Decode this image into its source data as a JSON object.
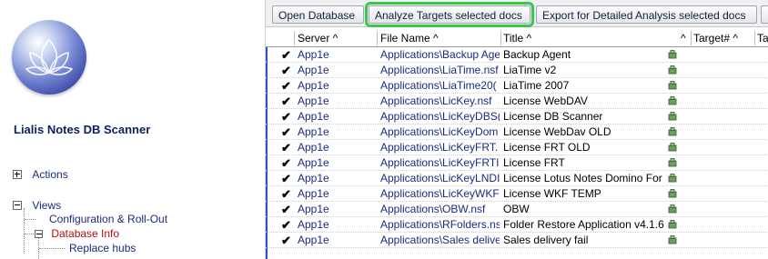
{
  "navigator": {
    "app_title": "Lialis Notes DB Scanner",
    "tree": [
      {
        "label": "Actions",
        "state": "collapsed"
      },
      {
        "label": "Views",
        "state": "expanded"
      }
    ],
    "views_children": [
      {
        "label": "Configuration & Roll-Out"
      },
      {
        "label": "Database Info",
        "state": "expanded",
        "active": true
      }
    ],
    "database_info_children": [
      {
        "label": "Replace hubs"
      }
    ]
  },
  "actionbar": {
    "buttons": [
      {
        "label": "Open Database"
      },
      {
        "label": "Analyze Targets selected docs",
        "highlighted": true
      },
      {
        "label": "Export for Detailed Analysis selected docs"
      }
    ]
  },
  "view": {
    "columns": [
      "Server ^",
      "File Name ^",
      "Title ^",
      "^",
      "Target# ^",
      "Ta"
    ],
    "rows": [
      {
        "checked": true,
        "server": "App1e",
        "file": "Applications\\Backup Age",
        "title": "Backup Agent"
      },
      {
        "checked": true,
        "server": "App1e",
        "file": "Applications\\LiaTime.nsf",
        "title": "LiaTime v2"
      },
      {
        "checked": true,
        "server": "App1e",
        "file": "Applications\\LiaTime20(",
        "title": "LiaTime 2007"
      },
      {
        "checked": true,
        "server": "App1e",
        "file": "Applications\\LicKey.nsf",
        "title": "License WebDAV"
      },
      {
        "checked": true,
        "server": "App1e",
        "file": "Applications\\LicKeyDBS(",
        "title": "License DB Scanner"
      },
      {
        "checked": true,
        "server": "App1e",
        "file": "Applications\\LicKeyDom",
        "title": "License WebDav OLD"
      },
      {
        "checked": true,
        "server": "App1e",
        "file": "Applications\\LicKeyFRT.",
        "title": "License FRT OLD"
      },
      {
        "checked": true,
        "server": "App1e",
        "file": "Applications\\LicKeyFRTI",
        "title": "License FRT"
      },
      {
        "checked": true,
        "server": "App1e",
        "file": "Applications\\LicKeyLNDI",
        "title": "License Lotus Notes Domino For"
      },
      {
        "checked": true,
        "server": "App1e",
        "file": "Applications\\LicKeyWKF",
        "title": "License WKF TEMP"
      },
      {
        "checked": true,
        "server": "App1e",
        "file": "Applications\\OBW.nsf",
        "title": "OBW"
      },
      {
        "checked": true,
        "server": "App1e",
        "file": "Applications\\RFolders.ns",
        "title": "Folder Restore Application v4.1.6"
      },
      {
        "checked": true,
        "server": "App1e",
        "file": "Applications\\Sales delive",
        "title": "Sales delivery fail"
      }
    ]
  },
  "colors": {
    "accent_highlight": "#37c94a",
    "link_text": "#1a2a80",
    "active_link": "#b01010"
  }
}
